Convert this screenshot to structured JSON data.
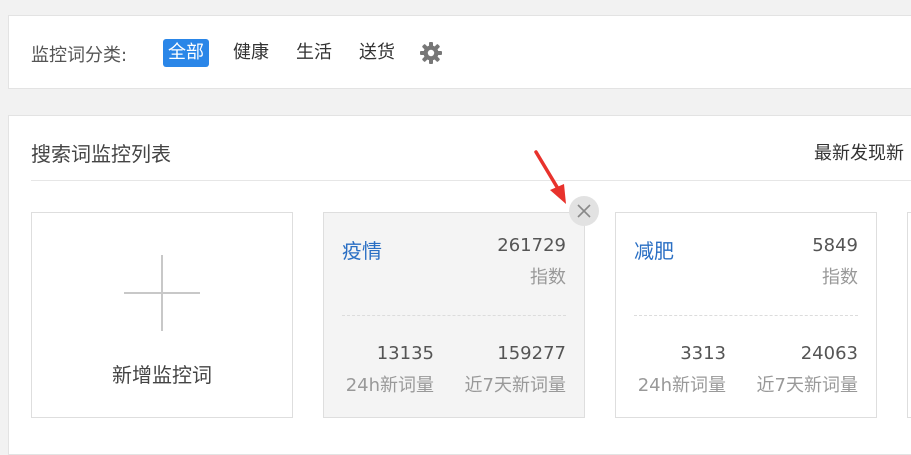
{
  "categories": {
    "label": "监控词分类:",
    "items": [
      "全部",
      "健康",
      "生活",
      "送货"
    ],
    "active": "全部"
  },
  "list": {
    "title": "搜索词监控列表",
    "latest_link": "最新发现新"
  },
  "add_card": {
    "label": "新增监控词"
  },
  "cards": [
    {
      "keyword": "疫情",
      "index_value": "261729",
      "index_label": "指数",
      "new_24h_value": "13135",
      "new_24h_label": "24h新词量",
      "new_7d_value": "159277",
      "new_7d_label": "近7天新词量"
    },
    {
      "keyword": "减肥",
      "index_value": "5849",
      "index_label": "指数",
      "new_24h_value": "3313",
      "new_24h_label": "24h新词量",
      "new_7d_value": "24063",
      "new_7d_label": "近7天新词量"
    }
  ],
  "colors": {
    "accent": "#2a86e8",
    "keyword_link": "#2a6fc4",
    "annotation_arrow": "#e8322c"
  },
  "icons": {
    "settings": "gear-icon",
    "close": "close-icon",
    "add": "plus-icon"
  }
}
